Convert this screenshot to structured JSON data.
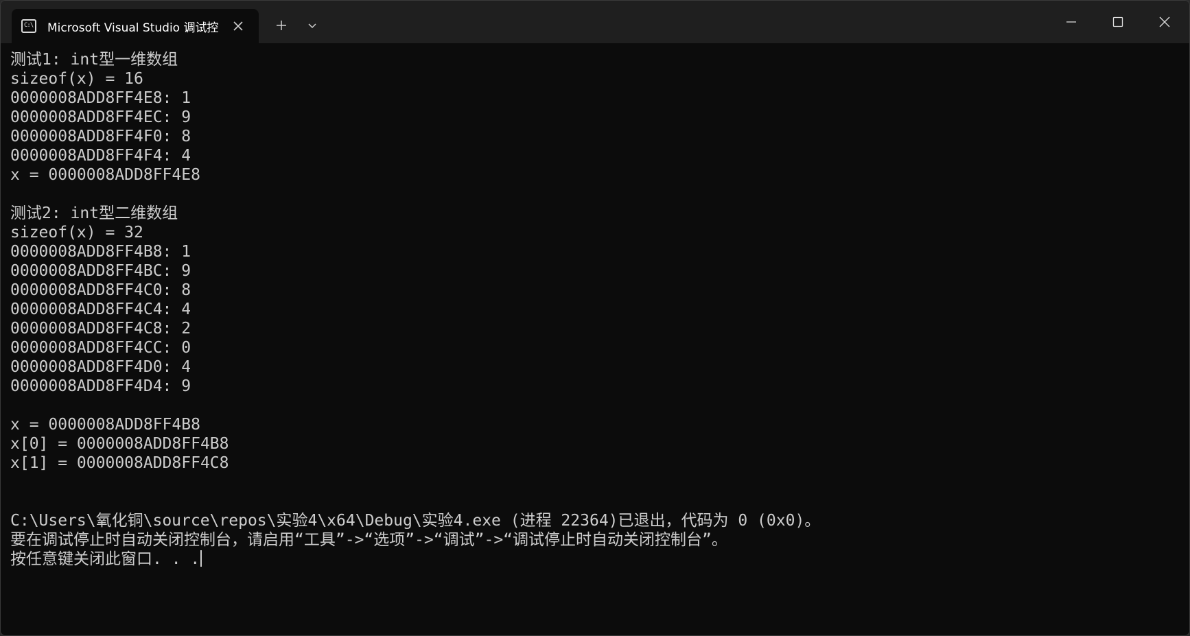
{
  "window": {
    "tab_title": "Microsoft Visual Studio 调试控制台",
    "tab_icon_glyph": "C:\\",
    "icons": {
      "tab": "console-icon",
      "close_tab": "close-icon",
      "new_tab": "plus-icon",
      "dropdown": "chevron-down-icon",
      "minimize": "minimize-icon",
      "maximize": "maximize-icon",
      "close": "close-icon"
    }
  },
  "colors": {
    "console_bg": "#0c0c0c",
    "titlebar_bg": "#1f1f1f",
    "text": "#cccccc"
  },
  "console": {
    "lines": [
      "测试1: int型一维数组",
      "sizeof(x) = 16",
      "0000008ADD8FF4E8: 1",
      "0000008ADD8FF4EC: 9",
      "0000008ADD8FF4F0: 8",
      "0000008ADD8FF4F4: 4",
      "x = 0000008ADD8FF4E8",
      "",
      "测试2: int型二维数组",
      "sizeof(x) = 32",
      "0000008ADD8FF4B8: 1",
      "0000008ADD8FF4BC: 9",
      "0000008ADD8FF4C0: 8",
      "0000008ADD8FF4C4: 4",
      "0000008ADD8FF4C8: 2",
      "0000008ADD8FF4CC: 0",
      "0000008ADD8FF4D0: 4",
      "0000008ADD8FF4D4: 9",
      "",
      "x = 0000008ADD8FF4B8",
      "x[0] = 0000008ADD8FF4B8",
      "x[1] = 0000008ADD8FF4C8",
      "",
      "",
      "C:\\Users\\氧化铜\\source\\repos\\实验4\\x64\\Debug\\实验4.exe (进程 22364)已退出，代码为 0 (0x0)。",
      "要在调试停止时自动关闭控制台，请启用“工具”->“选项”->“调试”->“调试停止时自动关闭控制台”。",
      "按任意键关闭此窗口. . ."
    ]
  }
}
